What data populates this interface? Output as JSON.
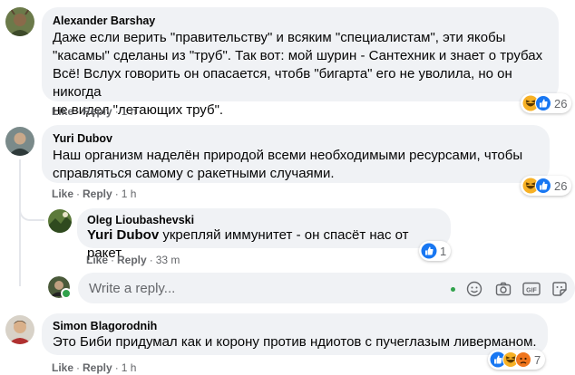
{
  "comments": [
    {
      "author": "Alexander Barshay",
      "text": "Даже если верить \"правительству\" и всяким \"специалистам\", эти якобы\n\"касамы\" сделаны из \"труб\". Так вот: мой шурин - Сантехник и знает о трубах\nВсё! Вслух говорить он опасается, чтобв \"бигарта\" его не уволила, но он никогда\nне видел \"летающих труб\".",
      "like": "Like",
      "reply": "Reply",
      "time": "1 h",
      "reaction_count": "26"
    },
    {
      "author": "Yuri Dubov",
      "text": "Наш организм наделён природой всеми необходимыми ресурсами, чтобы\nсправляться самому с ракетными случаями.",
      "like": "Like",
      "reply": "Reply",
      "time": "1 h",
      "reaction_count": "26"
    },
    {
      "author": "Simon Blagorodnih",
      "text": "Это Биби придумал как и корону против ндиотов с пучеглазым ливерманом.",
      "like": "Like",
      "reply": "Reply",
      "time": "1 h",
      "reaction_count": "7"
    }
  ],
  "reply": {
    "author": "Oleg Lioubashevski",
    "mention": "Yuri Dubov",
    "text": " укрепляй иммунитет - он спасёт нас от ракет",
    "like": "Like",
    "reply": "Reply",
    "time": "33 m",
    "reaction_count": "1"
  },
  "reply_box": {
    "placeholder": "Write a reply..."
  },
  "icons": [
    "haha-reaction-icon",
    "like-reaction-icon",
    "smiley-icon",
    "camera-icon",
    "gif-icon",
    "sticker-icon"
  ],
  "colors": {
    "like_blue": "#1877f2",
    "haha_yellow": "#f7b125",
    "bubble_gray": "#f0f2f5",
    "meta_gray": "#65676b",
    "online_green": "#31a24c"
  }
}
